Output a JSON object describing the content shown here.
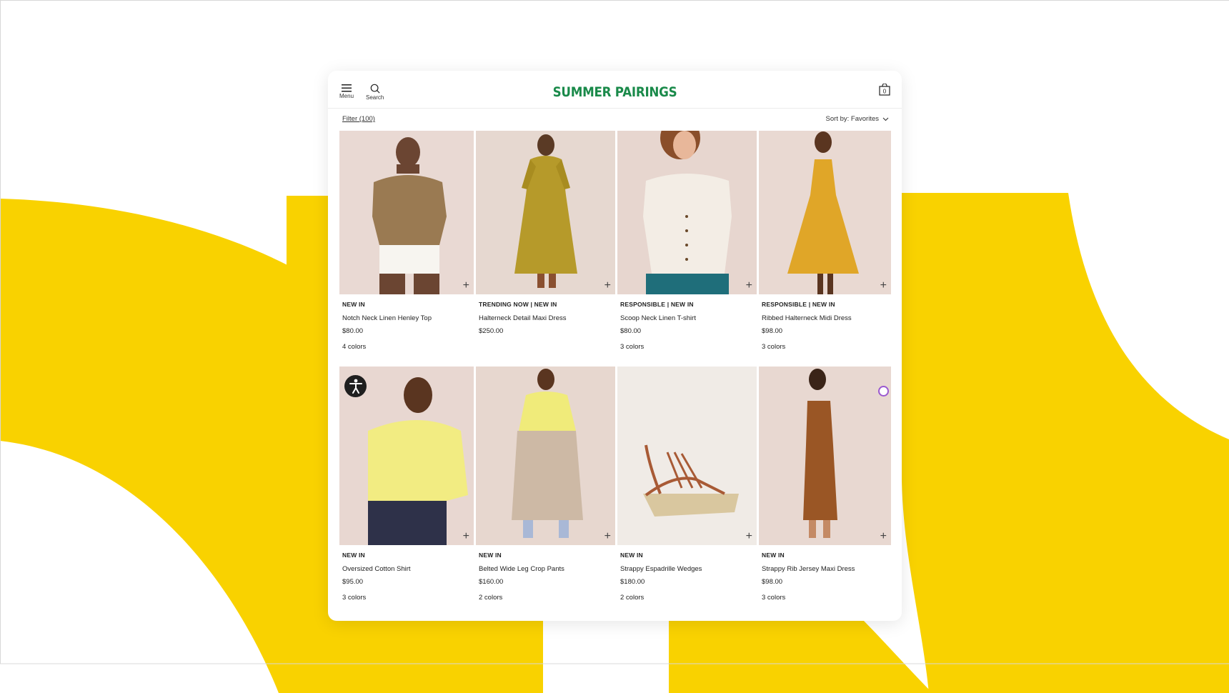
{
  "header": {
    "menu_label": "Menu",
    "search_label": "Search",
    "brand": "SUMMER PAIRINGS",
    "bag_count": "0"
  },
  "toolbar": {
    "filter_label": "Filter (100)",
    "sort_label": "Sort by: Favorites"
  },
  "products": [
    {
      "tag": "NEW IN",
      "name": "Notch Neck Linen Henley Top",
      "price": "$80.00",
      "colors": "4 colors"
    },
    {
      "tag": "TRENDING NOW | NEW IN",
      "name": "Halterneck Detail Maxi Dress",
      "price": "$250.00",
      "colors": ""
    },
    {
      "tag": "RESPONSIBLE | NEW IN",
      "name": "Scoop Neck Linen T-shirt",
      "price": "$80.00",
      "colors": "3 colors"
    },
    {
      "tag": "RESPONSIBLE | NEW IN",
      "name": "Ribbed Halterneck Midi Dress",
      "price": "$98.00",
      "colors": "3 colors"
    },
    {
      "tag": "NEW IN",
      "name": "Oversized Cotton Shirt",
      "price": "$95.00",
      "colors": "3 colors"
    },
    {
      "tag": "NEW IN",
      "name": "Belted Wide Leg Crop Pants",
      "price": "$160.00",
      "colors": "2 colors"
    },
    {
      "tag": "NEW IN",
      "name": "Strappy Espadrille Wedges",
      "price": "$180.00",
      "colors": "2 colors"
    },
    {
      "tag": "NEW IN",
      "name": "Strappy Rib Jersey Maxi Dress",
      "price": "$98.00",
      "colors": "3 colors"
    }
  ],
  "icons": {
    "menu": "hamburger-icon",
    "search": "search-icon",
    "bag": "shopping-bag-icon",
    "add": "plus-icon",
    "sort": "chevron-down-icon",
    "accessibility": "accessibility-icon",
    "chat": "chat-icon"
  },
  "colors": {
    "brand": "#1a8a4a",
    "background_accent": "#f9d200"
  }
}
